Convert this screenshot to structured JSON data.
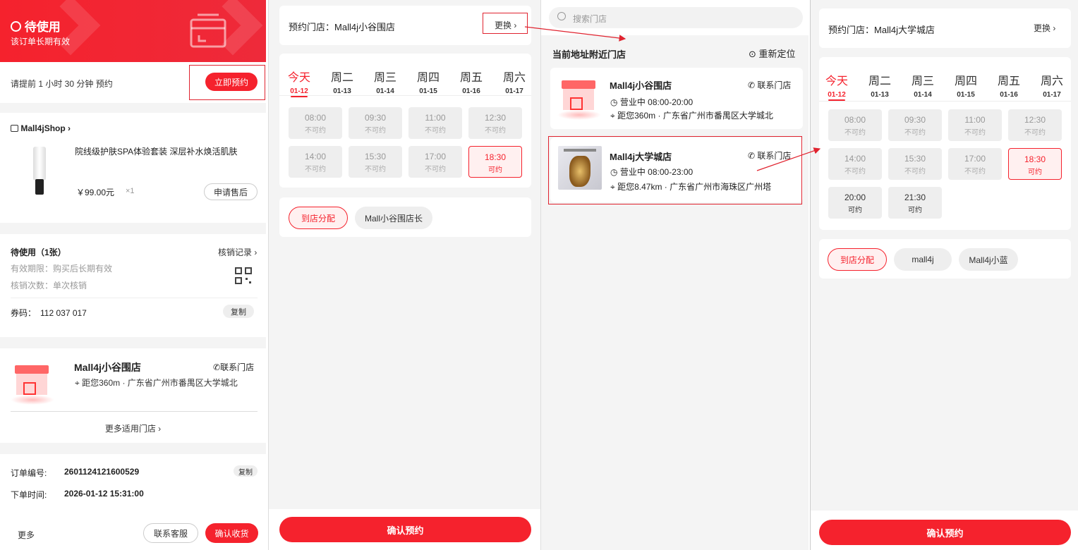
{
  "p1": {
    "status_title": "待使用",
    "status_sub": "该订单长期有效",
    "advance_text": "请提前 1 小时 30 分钟 预约",
    "book_now": "立即预约",
    "shop_name": "Mall4jShop",
    "product_name": "院线级护肤SPA体验套装 深层补水焕活肌肤",
    "price": "￥99.00元",
    "qty": "×1",
    "after_sale": "申请售后",
    "coupon_title": "待使用（1张）",
    "verify_record": "核销记录",
    "validity": "有效期限：购买后长期有效",
    "verify_times": "核销次数：单次核销",
    "coupon_code_label": "券码：",
    "coupon_code": "112 037 017",
    "copy": "复制",
    "store_name": "Mall4j小谷围店",
    "contact_store": "联系门店",
    "store_addr": "距您360m · 广东省广州市番禺区大学城北",
    "more_stores": "更多适用门店",
    "order_no_label": "订单编号:",
    "order_no": "2601124121600529",
    "order_copy": "复制",
    "order_time_label": "下单时间:",
    "order_time": "2026-01-12 15:31:00",
    "more": "更多",
    "contact_service": "联系客服",
    "confirm_receipt": "确认收货"
  },
  "p2": {
    "store_label": "预约门店：",
    "store_name": "Mall4j小谷围店",
    "change": "更换",
    "days": [
      {
        "w": "今天",
        "d": "01-12"
      },
      {
        "w": "周二",
        "d": "01-13"
      },
      {
        "w": "周三",
        "d": "01-14"
      },
      {
        "w": "周四",
        "d": "01-15"
      },
      {
        "w": "周五",
        "d": "01-16"
      },
      {
        "w": "周六",
        "d": "01-17"
      }
    ],
    "slots": [
      {
        "t": "08:00",
        "s": "不可约"
      },
      {
        "t": "09:30",
        "s": "不可约"
      },
      {
        "t": "11:00",
        "s": "不可约"
      },
      {
        "t": "12:30",
        "s": "不可约"
      },
      {
        "t": "14:00",
        "s": "不可约"
      },
      {
        "t": "15:30",
        "s": "不可约"
      },
      {
        "t": "17:00",
        "s": "不可约"
      },
      {
        "t": "18:30",
        "s": "可约"
      }
    ],
    "tags": [
      "到店分配",
      "Mall小谷围店长"
    ],
    "confirm": "确认预约"
  },
  "p3": {
    "search_placeholder": "搜索门店",
    "nearby_title": "当前地址附近门店",
    "relocate": "重新定位",
    "stores": [
      {
        "name": "Mall4j小谷围店",
        "contact": "联系门店",
        "hours": "营业中 08:00-20:00",
        "dist": "距您360m",
        "addr": "广东省广州市番禺区大学城北"
      },
      {
        "name": "Mall4j大学城店",
        "contact": "联系门店",
        "hours": "营业中 08:00-23:00",
        "dist": "距您8.47km",
        "addr": "广东省广州市海珠区广州塔"
      }
    ]
  },
  "p4": {
    "store_label": "预约门店：",
    "store_name": "Mall4j大学城店",
    "change": "更换",
    "days": [
      {
        "w": "今天",
        "d": "01-12"
      },
      {
        "w": "周二",
        "d": "01-13"
      },
      {
        "w": "周三",
        "d": "01-14"
      },
      {
        "w": "周四",
        "d": "01-15"
      },
      {
        "w": "周五",
        "d": "01-16"
      },
      {
        "w": "周六",
        "d": "01-17"
      }
    ],
    "slots": [
      {
        "t": "08:00",
        "s": "不可约"
      },
      {
        "t": "09:30",
        "s": "不可约"
      },
      {
        "t": "11:00",
        "s": "不可约"
      },
      {
        "t": "12:30",
        "s": "不可约"
      },
      {
        "t": "14:00",
        "s": "不可约"
      },
      {
        "t": "15:30",
        "s": "不可约"
      },
      {
        "t": "17:00",
        "s": "不可约"
      },
      {
        "t": "18:30",
        "s": "可约"
      },
      {
        "t": "20:00",
        "s": "可约"
      },
      {
        "t": "21:30",
        "s": "可约"
      }
    ],
    "tags": [
      "到店分配",
      "mall4j",
      "Mall4j小蓝"
    ],
    "confirm": "确认预约"
  }
}
